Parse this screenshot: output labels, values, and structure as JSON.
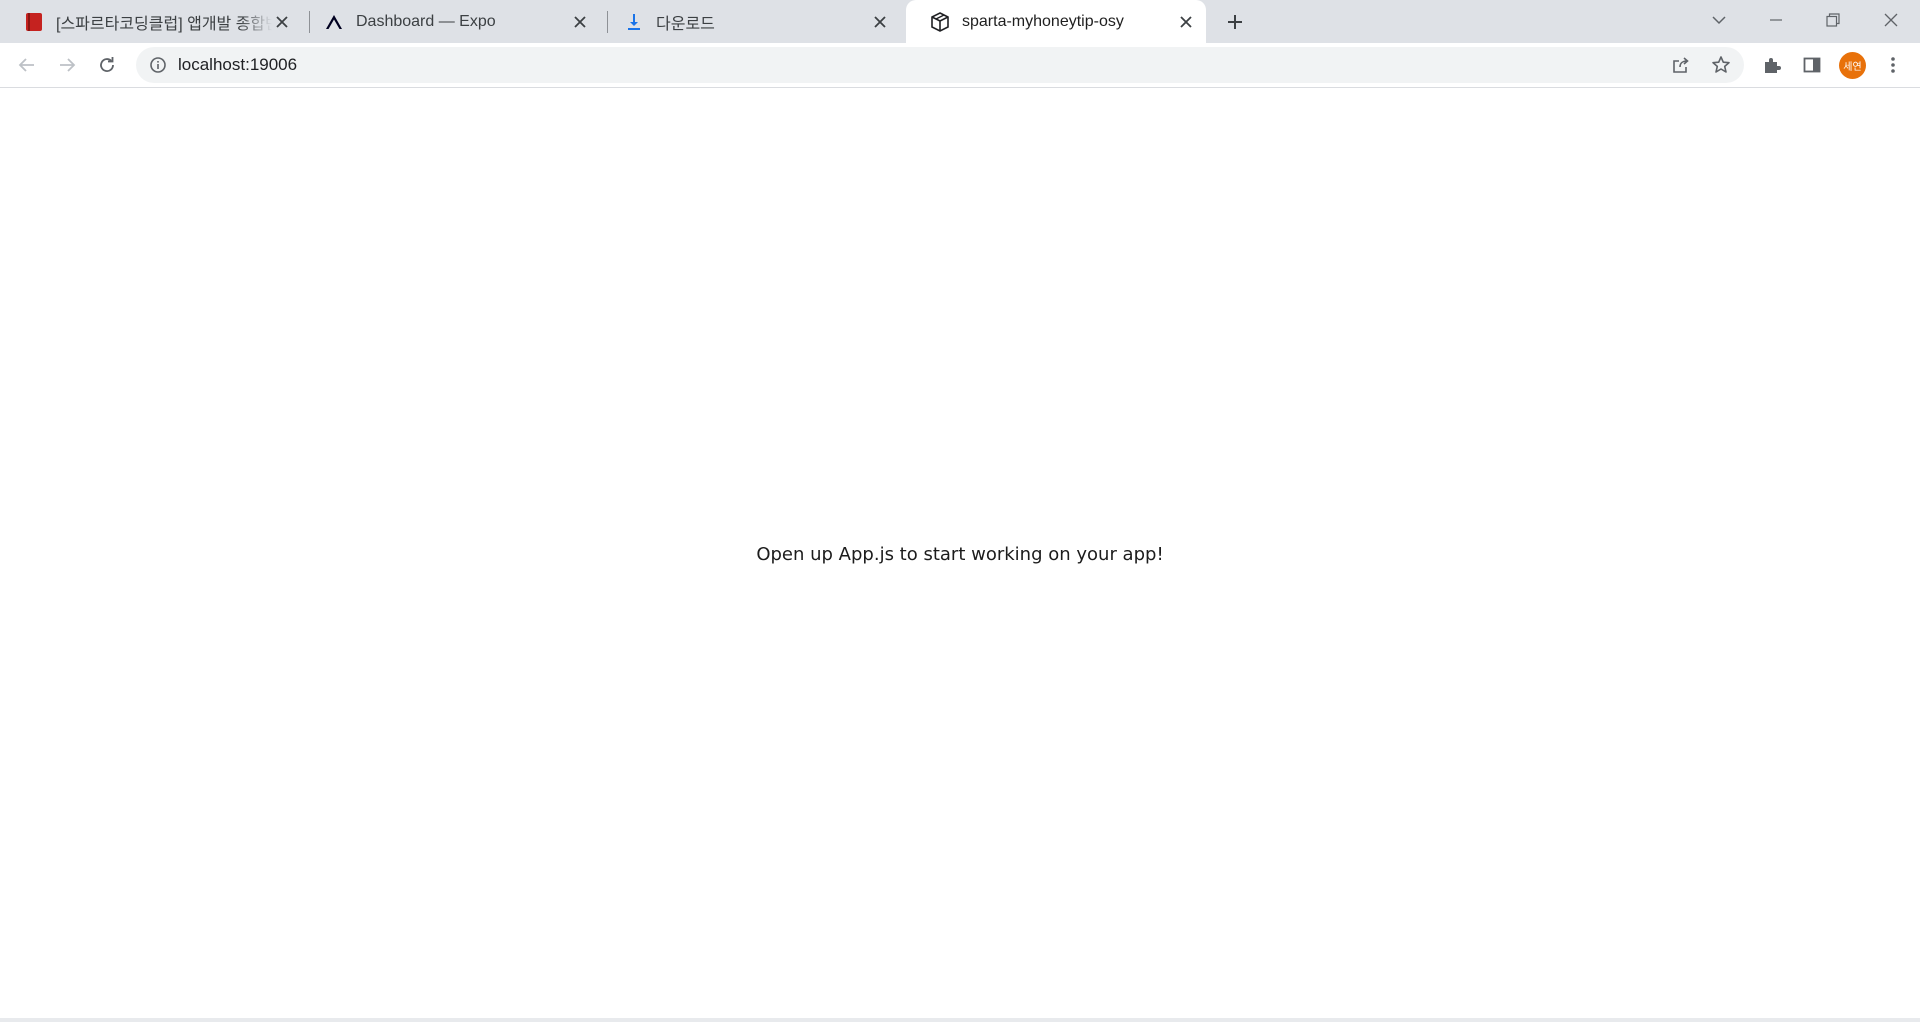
{
  "browser": {
    "tabs": [
      {
        "title": "[스파르타코딩클럽] 앱개발 종합반",
        "favicon": "book-icon",
        "active": false
      },
      {
        "title": "Dashboard — Expo",
        "favicon": "expo-icon",
        "active": false
      },
      {
        "title": "다운로드",
        "favicon": "download-icon",
        "active": false
      },
      {
        "title": "sparta-myhoneytip-osy",
        "favicon": "expo-cube-icon",
        "active": true
      }
    ],
    "address": "localhost:19006",
    "profile_initials": "세연"
  },
  "page": {
    "message": "Open up App.js to start working on your app!"
  },
  "colors": {
    "tabstrip_bg": "#dee1e6",
    "omnibox_bg": "#f1f3f4",
    "avatar_bg": "#e8710a",
    "book_icon": "#c5221f",
    "download_icon": "#1a73e8"
  }
}
